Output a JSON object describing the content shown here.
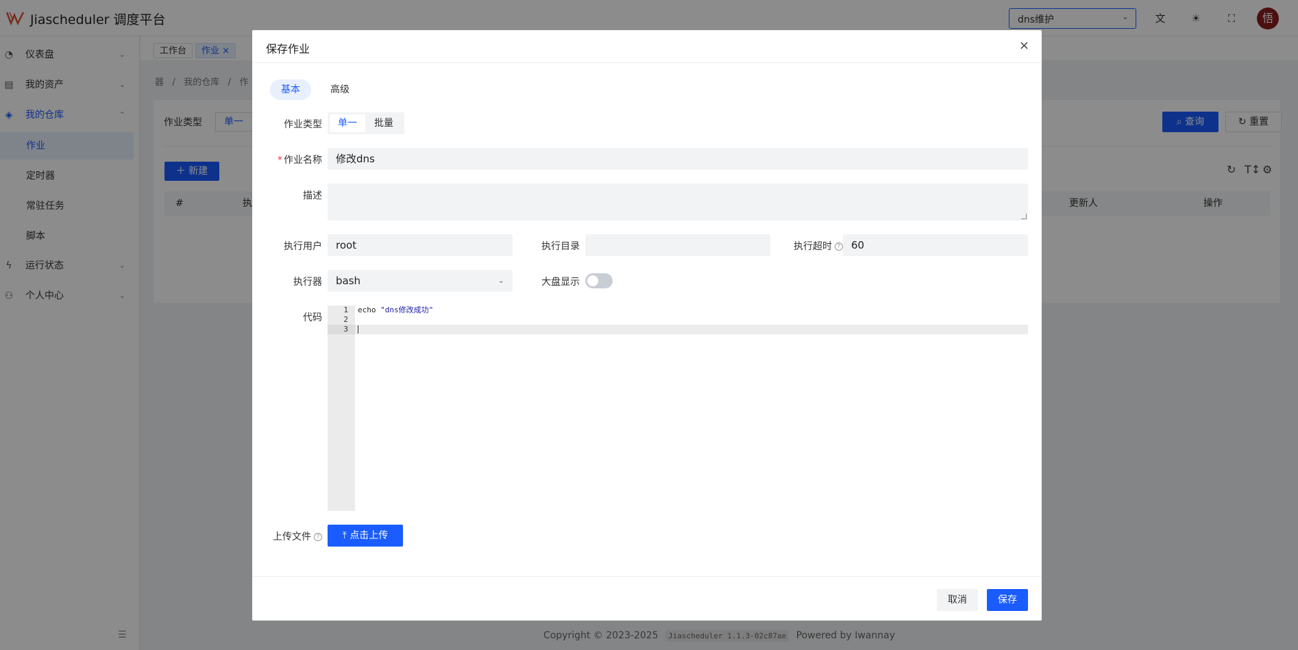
{
  "header": {
    "app_title": "Jiascheduler 调度平台",
    "project_select": "dns维护",
    "avatar_text": "悟"
  },
  "sidebar": {
    "items": [
      {
        "label": "仪表盘",
        "icon": "dashboard-icon"
      },
      {
        "label": "我的资产",
        "icon": "assets-icon"
      },
      {
        "label": "我的仓库",
        "icon": "layers-icon"
      },
      {
        "label": "运行状态",
        "icon": "lightning-icon"
      },
      {
        "label": "个人中心",
        "icon": "user-icon"
      }
    ],
    "sub_items": [
      "作业",
      "定时器",
      "常驻任务",
      "脚本"
    ]
  },
  "tabs": [
    "工作台",
    "作业"
  ],
  "breadcrumb": [
    "器",
    "我的仓库",
    "作"
  ],
  "filter": {
    "type_label": "作业类型",
    "type_value": "单一",
    "query": "查询",
    "reset": "重置",
    "new": "新建"
  },
  "table": {
    "headers": [
      "#",
      "执",
      "更新人",
      "操作"
    ]
  },
  "footer": {
    "copyright": "Copyright © 2023-2025",
    "version": "Jiascheduler 1.1.3-02c87ae",
    "powered": "Powered by Iwannay"
  },
  "modal": {
    "title": "保存作业",
    "tabs": [
      "基本",
      "高级"
    ],
    "job_type_label": "作业类型",
    "job_type_options": [
      "单一",
      "批量"
    ],
    "name_label": "作业名称",
    "name_value": "修改dns",
    "desc_label": "描述",
    "desc_value": "",
    "user_label": "执行用户",
    "user_value": "root",
    "dir_label": "执行目录",
    "dir_value": "",
    "timeout_label": "执行超时",
    "timeout_value": "60",
    "executor_label": "执行器",
    "executor_value": "bash",
    "dashboard_label": "大盘显示",
    "dashboard_on": false,
    "code_label": "代码",
    "code_lines": [
      "1",
      "2",
      "3"
    ],
    "code_cmd": "echo ",
    "code_str": "\"dns修改成功\"",
    "upload_label": "上传文件",
    "upload_btn": "点击上传",
    "cancel": "取消",
    "save": "保存"
  },
  "colors": {
    "primary": "#1a5cff",
    "avatar": "#8b1e1e"
  }
}
